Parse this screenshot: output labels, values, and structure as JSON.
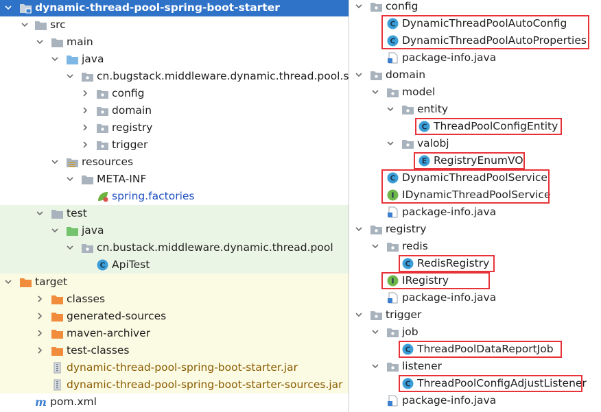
{
  "colors": {
    "selection": "#2f73c9",
    "folder": "#a9b3bd",
    "source_folder": "#7cb7e6",
    "test_folder": "#72c36b",
    "target_folder": "#f08c3c",
    "class_icon": "#3b9ed8",
    "interface_icon": "#6fb74a",
    "enum_icon": "#3b9ed8",
    "highlight_box": "#e8323a"
  },
  "left_tree": [
    {
      "label": "dynamic-thread-pool-spring-boot-starter",
      "icon": "module-folder-icon",
      "arrow": "down",
      "selected": true
    },
    {
      "label": "src",
      "icon": "folder-icon",
      "arrow": "down"
    },
    {
      "label": "main",
      "icon": "folder-icon",
      "arrow": "down"
    },
    {
      "label": "java",
      "icon": "source-folder-icon",
      "arrow": "down"
    },
    {
      "label": "cn.bugstack.middleware.dynamic.thread.pool.sdk",
      "icon": "package-icon",
      "arrow": "down"
    },
    {
      "label": "config",
      "icon": "package-icon",
      "arrow": "right"
    },
    {
      "label": "domain",
      "icon": "package-icon",
      "arrow": "right"
    },
    {
      "label": "registry",
      "icon": "package-icon",
      "arrow": "right"
    },
    {
      "label": "trigger",
      "icon": "package-icon",
      "arrow": "right"
    },
    {
      "label": "resources",
      "icon": "resources-folder-icon",
      "arrow": "down"
    },
    {
      "label": "META-INF",
      "icon": "folder-icon",
      "arrow": "down"
    },
    {
      "label": "spring.factories",
      "icon": "spring-leaf-icon",
      "arrow": "none"
    },
    {
      "label": "test",
      "icon": "folder-icon",
      "arrow": "down"
    },
    {
      "label": "java",
      "icon": "test-folder-icon",
      "arrow": "down"
    },
    {
      "label": "cn.bustack.middleware.dynamic.thread.pool",
      "icon": "package-icon",
      "arrow": "down"
    },
    {
      "label": "ApiTest",
      "icon": "class-icon",
      "arrow": "none"
    },
    {
      "label": "target",
      "icon": "target-folder-icon",
      "arrow": "down"
    },
    {
      "label": "classes",
      "icon": "target-folder-icon",
      "arrow": "right"
    },
    {
      "label": "generated-sources",
      "icon": "target-folder-icon",
      "arrow": "right"
    },
    {
      "label": "maven-archiver",
      "icon": "target-folder-icon",
      "arrow": "right"
    },
    {
      "label": "test-classes",
      "icon": "target-folder-icon",
      "arrow": "right"
    },
    {
      "label": "dynamic-thread-pool-spring-boot-starter.jar",
      "icon": "jar-icon",
      "arrow": "none"
    },
    {
      "label": "dynamic-thread-pool-spring-boot-starter-sources.jar",
      "icon": "jar-icon",
      "arrow": "none"
    },
    {
      "label": "pom.xml",
      "icon": "maven-icon",
      "arrow": "none"
    }
  ],
  "right_tree": [
    {
      "label": "config",
      "icon": "package-icon",
      "arrow": "down"
    },
    {
      "label": "DynamicThreadPoolAutoConfig",
      "icon": "class-icon",
      "arrow": "none"
    },
    {
      "label": "DynamicThreadPoolAutoProperties",
      "icon": "class-icon",
      "arrow": "none"
    },
    {
      "label": "package-info.java",
      "icon": "java-file-icon",
      "arrow": "none"
    },
    {
      "label": "domain",
      "icon": "package-icon",
      "arrow": "down"
    },
    {
      "label": "model",
      "icon": "package-icon",
      "arrow": "down"
    },
    {
      "label": "entity",
      "icon": "package-icon",
      "arrow": "down"
    },
    {
      "label": "ThreadPoolConfigEntity",
      "icon": "class-icon",
      "arrow": "none"
    },
    {
      "label": "valobj",
      "icon": "package-icon",
      "arrow": "down"
    },
    {
      "label": "RegistryEnumVO",
      "icon": "enum-icon",
      "arrow": "none"
    },
    {
      "label": "DynamicThreadPoolService",
      "icon": "class-icon",
      "arrow": "none"
    },
    {
      "label": "IDynamicThreadPoolService",
      "icon": "interface-icon",
      "arrow": "none"
    },
    {
      "label": "package-info.java",
      "icon": "java-file-icon",
      "arrow": "none"
    },
    {
      "label": "registry",
      "icon": "package-icon",
      "arrow": "down"
    },
    {
      "label": "redis",
      "icon": "package-icon",
      "arrow": "down"
    },
    {
      "label": "RedisRegistry",
      "icon": "class-icon",
      "arrow": "none"
    },
    {
      "label": "IRegistry",
      "icon": "interface-icon",
      "arrow": "none"
    },
    {
      "label": "package-info.java",
      "icon": "java-file-icon",
      "arrow": "none"
    },
    {
      "label": "trigger",
      "icon": "package-icon",
      "arrow": "down"
    },
    {
      "label": "job",
      "icon": "package-icon",
      "arrow": "down"
    },
    {
      "label": "ThreadPoolDataReportJob",
      "icon": "class-icon",
      "arrow": "none"
    },
    {
      "label": "listener",
      "icon": "package-icon",
      "arrow": "down"
    },
    {
      "label": "ThreadPoolConfigAdjustListener",
      "icon": "class-icon",
      "arrow": "none"
    },
    {
      "label": "package-info.java",
      "icon": "java-file-icon",
      "arrow": "none"
    }
  ]
}
